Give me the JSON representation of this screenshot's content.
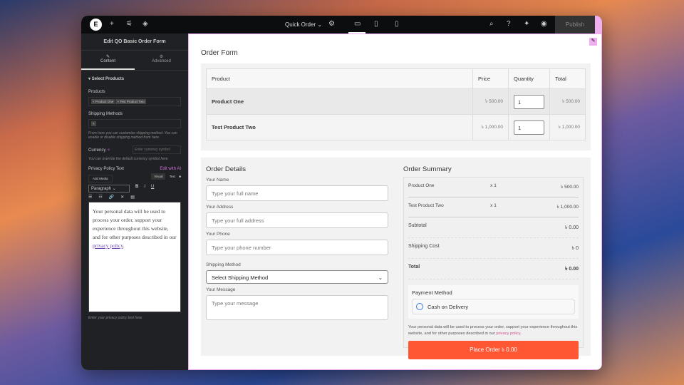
{
  "topbar": {
    "page": "Quick Order",
    "publish": "Publish"
  },
  "panel": {
    "title": "Edit QO Basic Order Form",
    "tabs": [
      "Content",
      "Advanced"
    ],
    "section": "Select Products",
    "products_label": "Products",
    "products": [
      "× Product One",
      "× Test Product Two"
    ],
    "shipping_label": "Shipping Methods",
    "shipping_tag": "×",
    "shipping_help": "From here you can customize shipping method. You can enable or disable shipping method from here.",
    "currency_label": "Currency",
    "currency_placeholder": "Enter currency symbol",
    "currency_help": "You can override the default currency symbol here.",
    "privacy_label": "Privacy Policy Text",
    "edit_ai": "Edit with AI",
    "add_media": "Add Media",
    "visual": "Visual",
    "text": "Text",
    "format": "Paragraph",
    "privacy_text": "Your personal data will be used to process your order, support your experience throughout this website, and for other purposes described in our ",
    "privacy_link": "privacy policy",
    "privacy_end": ".",
    "privacy_help": "Enter your privacy policy text here"
  },
  "form": {
    "title": "Order Form",
    "headers": [
      "Product",
      "Price",
      "Quantity",
      "Total"
    ],
    "rows": [
      {
        "product": "Product One",
        "price": "৳ 500.00",
        "qty": "1",
        "total": "৳ 500.00"
      },
      {
        "product": "Test Product Two",
        "price": "৳ 1,000.00",
        "qty": "1",
        "total": "৳ 1,000.00"
      }
    ],
    "details_title": "Order Details",
    "name_label": "Your Name",
    "name_ph": "Type your full name",
    "address_label": "Your Address",
    "address_ph": "Type your full address",
    "phone_label": "Your Phone",
    "phone_ph": "Type your phone number",
    "shipping_label": "Shipping Method",
    "shipping_value": "Select Shipping Method",
    "message_label": "Your Message",
    "message_ph": "Type your message",
    "summary_title": "Order Summary",
    "summary_items": [
      {
        "name": "Product One",
        "qty": "x 1",
        "price": "৳ 500.00"
      },
      {
        "name": "Test Product Two",
        "qty": "x 1",
        "price": "৳ 1,000.00"
      }
    ],
    "subtotal_label": "Subtotal",
    "subtotal": "৳ 0.00",
    "shipping_cost_label": "Shipping Cost",
    "shipping_cost": "৳ 0",
    "total_label": "Total",
    "total": "৳ 0.00",
    "payment_title": "Payment Method",
    "payment_option": "Cash on Delivery",
    "privacy_text": "Your personal data will be used to process your order, support your experience throughout this website, and for other purposes described in our ",
    "privacy_link": "privacy policy",
    "privacy_end": ".",
    "place_order": "Place Order ৳ 0.00",
    "accent": "#ff5733"
  }
}
